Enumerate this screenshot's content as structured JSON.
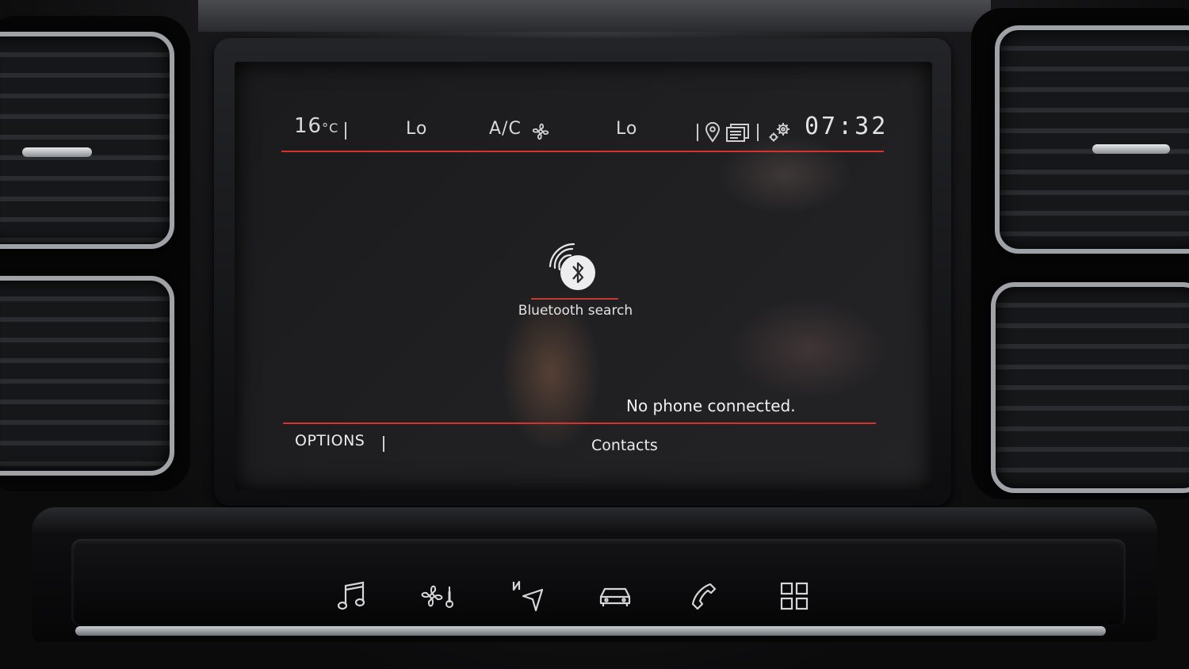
{
  "status_bar": {
    "temperature_value": "16",
    "temperature_unit": "°C",
    "left_fan_level": "Lo",
    "ac_label": "A/C",
    "right_fan_level": "Lo",
    "clock": "07:32"
  },
  "main": {
    "bluetooth_label": "Bluetooth search",
    "connection_status": "No phone connected."
  },
  "bottom_bar": {
    "options_label": "OPTIONS",
    "contacts_label": "Contacts"
  },
  "console_buttons": [
    {
      "icon": "music-note-icon"
    },
    {
      "icon": "climate-icon"
    },
    {
      "icon": "navigation-icon"
    },
    {
      "icon": "car-icon"
    },
    {
      "icon": "phone-icon"
    },
    {
      "icon": "apps-grid-icon"
    }
  ],
  "colors": {
    "accent_red": "#d9322e",
    "text": "#e2e2e4",
    "screen_bg": "#1c1c1e"
  }
}
